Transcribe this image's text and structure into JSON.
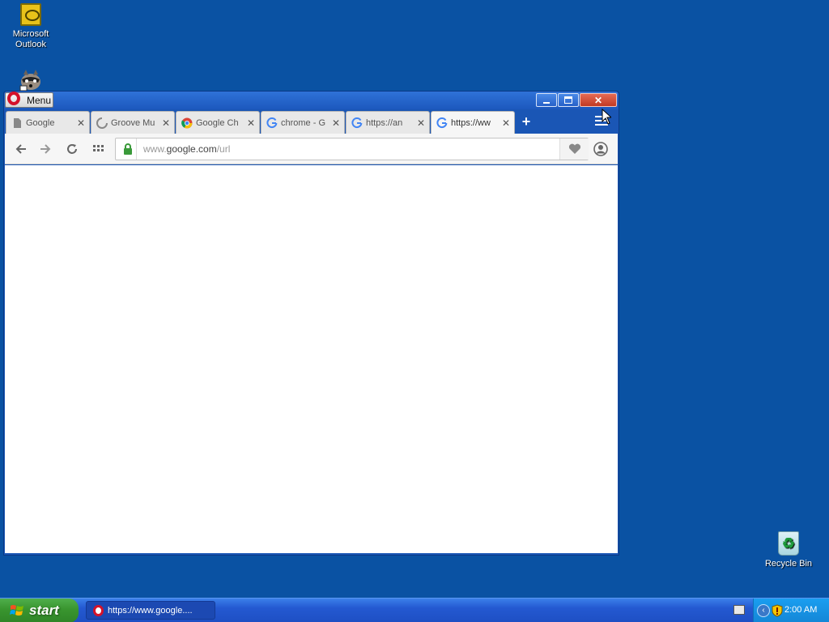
{
  "desktop": {
    "icons": [
      {
        "label": "Microsoft Outlook"
      },
      {
        "label": "Recycle Bin"
      }
    ]
  },
  "browser": {
    "menu_label": "Menu",
    "tabs": [
      {
        "title": "Google",
        "icon": "page-icon"
      },
      {
        "title": "Groove Mu",
        "icon": "loading-icon"
      },
      {
        "title": "Google Ch",
        "icon": "chrome-icon"
      },
      {
        "title": "chrome - G",
        "icon": "google-g-icon"
      },
      {
        "title": "https://an",
        "icon": "google-g-icon"
      },
      {
        "title": "https://ww",
        "icon": "google-g-icon",
        "active": true
      }
    ],
    "address": {
      "prefix": "www.",
      "host": "google.com",
      "path": "/url"
    }
  },
  "taskbar": {
    "start_label": "start",
    "task_item": "https://www.google....",
    "clock": "2:00 AM"
  },
  "colors": {
    "desktop_bg": "#0a52a3",
    "titlebar": "#1c58bd",
    "close_button": "#c13a24",
    "opera_red": "#d4122a",
    "start_green": "#39952f"
  }
}
